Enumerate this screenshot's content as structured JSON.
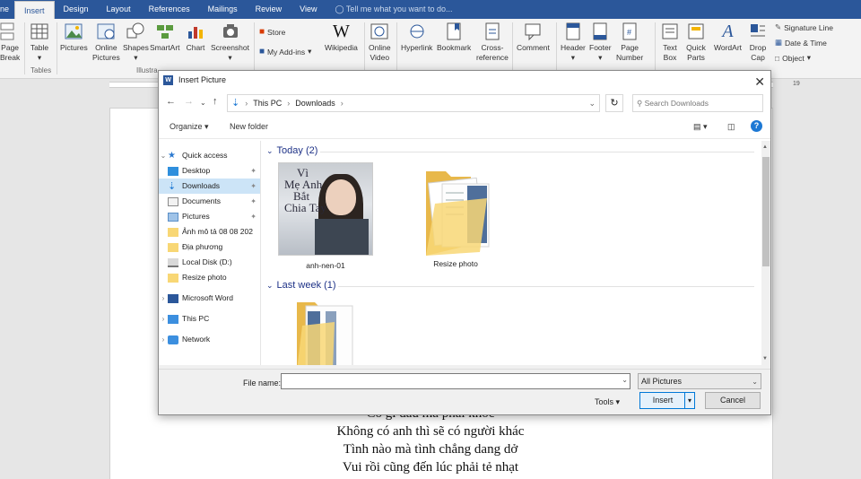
{
  "ribbon_tabs": [
    "ne",
    "Insert",
    "Design",
    "Layout",
    "References",
    "Mailings",
    "Review",
    "View"
  ],
  "tell_me": "Tell me what you want to do...",
  "ribbon": {
    "page_break": [
      "Page",
      "Break"
    ],
    "table": [
      "Table",
      ""
    ],
    "pictures": [
      "Pictures",
      ""
    ],
    "online_pictures": [
      "Online",
      "Pictures"
    ],
    "shapes": [
      "Shapes",
      ""
    ],
    "smartart": [
      "SmartArt",
      ""
    ],
    "chart": [
      "Chart",
      ""
    ],
    "screenshot": [
      "Screenshot",
      ""
    ],
    "store": "Store",
    "my_addins": "My Add-ins",
    "wikipedia": "Wikipedia",
    "online_video": [
      "Online",
      "Video"
    ],
    "hyperlink": "Hyperlink",
    "bookmark": "Bookmark",
    "cross_reference": [
      "Cross-",
      "reference"
    ],
    "comment": "Comment",
    "header": [
      "Header",
      ""
    ],
    "footer": [
      "Footer",
      ""
    ],
    "page_number": [
      "Page",
      "Number"
    ],
    "text_box": [
      "Text",
      "Box"
    ],
    "quick_parts": [
      "Quick",
      "Parts"
    ],
    "wordart": [
      "WordArt",
      ""
    ],
    "drop_cap": [
      "Drop",
      "Cap"
    ],
    "signature_line": "Signature Line",
    "date_time": "Date & Time",
    "object": "Object",
    "group_tables": "Tables",
    "group_illus": "Illustra"
  },
  "ruler_numbers": [
    "1",
    "19"
  ],
  "dialog": {
    "title": "Insert Picture",
    "breadcrumb": [
      "This PC",
      "Downloads"
    ],
    "search_placeholder": "Search Downloads",
    "organize": "Organize",
    "new_folder": "New folder",
    "nav": {
      "quick_access": "Quick access",
      "desktop": "Desktop",
      "downloads": "Downloads",
      "documents": "Documents",
      "pictures": "Pictures",
      "folder1": "Ảnh mô tả 08 08 202",
      "folder2": "Địa phương",
      "local_disk": "Local Disk (D:)",
      "resize_photo": "Resize photo",
      "microsoft_word": "Microsoft Word",
      "this_pc": "This PC",
      "network": "Network"
    },
    "groups": {
      "today": "Today (2)",
      "last_week": "Last week (1)"
    },
    "files": [
      {
        "name": "anh-nen-01",
        "overlay": [
          "Vì",
          "Mẹ Anh",
          "Bắt",
          "Chia Tay"
        ]
      },
      {
        "name": "Resize photo"
      }
    ],
    "file_name_label": "File name:",
    "file_name_value": "",
    "file_type": "All Pictures",
    "tools": "Tools",
    "insert": "Insert",
    "cancel": "Cancel"
  },
  "document_lines": [
    "Có gì đâu mà phải khóc",
    "Không có anh thì sẽ có người khác",
    "Tình nào mà tình chẳng dang dở",
    "Vui rồi cũng đến lúc phải tẻ nhạt"
  ],
  "colors": {
    "word_blue": "#2b579a",
    "selection": "#cce4f7",
    "group_header": "#1e3287"
  }
}
